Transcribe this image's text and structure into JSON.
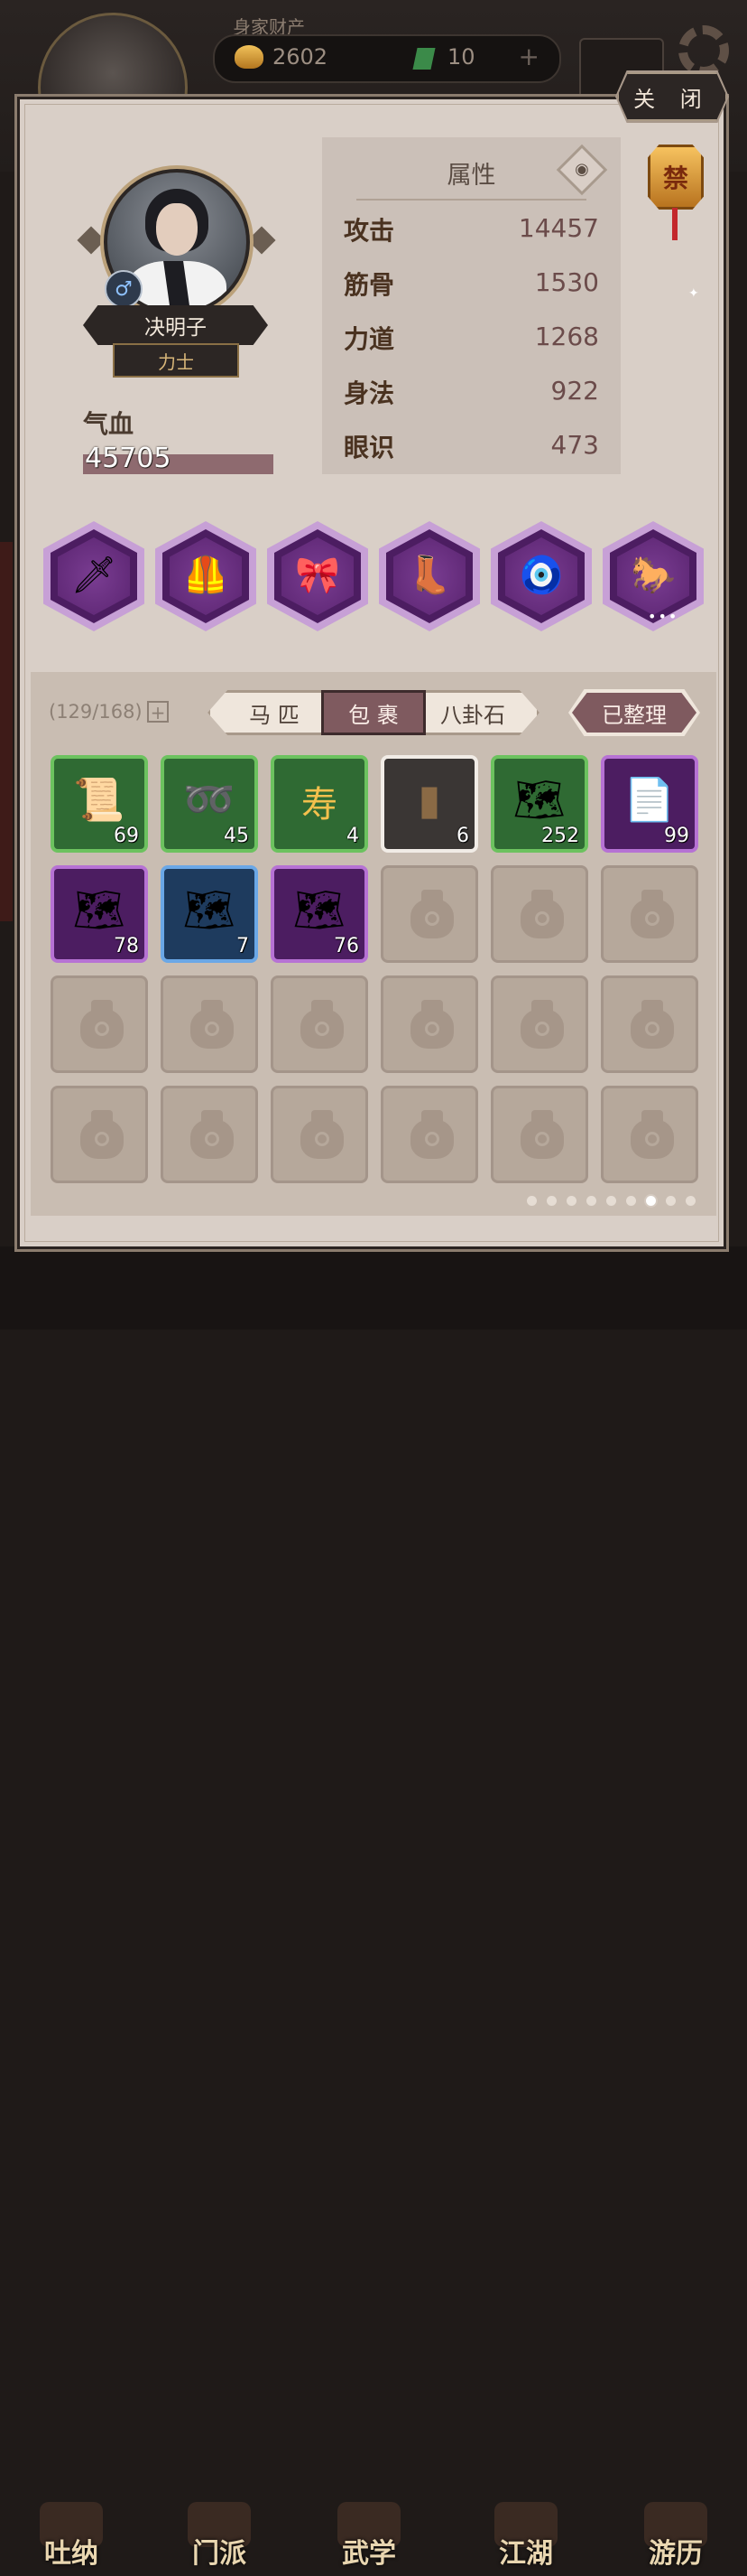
{
  "background": {
    "assets_label": "身家财产",
    "gold": "2602",
    "jade": "10",
    "bottom_tabs": [
      "吐纳",
      "门派",
      "武学",
      "江湖",
      "游历"
    ]
  },
  "dialog": {
    "close_label": "关 闭",
    "character": {
      "name": "决明子",
      "class": "力士",
      "gender_symbol": "♂",
      "hp_label": "气血",
      "hp_value": "45705"
    },
    "attributes": {
      "title": "属性",
      "rows": [
        {
          "label": "攻击",
          "value": "14457"
        },
        {
          "label": "筋骨",
          "value": "1530"
        },
        {
          "label": "力道",
          "value": "1268"
        },
        {
          "label": "身法",
          "value": "922"
        },
        {
          "label": "眼识",
          "value": "473"
        }
      ]
    },
    "badge_char": "禁",
    "equipment": [
      {
        "name": "weapon-slot",
        "icon": "sword-icon",
        "glyph": "🗡"
      },
      {
        "name": "armor-slot",
        "icon": "armor-icon",
        "glyph": "🦺"
      },
      {
        "name": "belt-slot",
        "icon": "belt-icon",
        "glyph": "🎀"
      },
      {
        "name": "boots-slot",
        "icon": "boots-icon",
        "glyph": "👢"
      },
      {
        "name": "pendant-slot",
        "icon": "pendant-icon",
        "glyph": "🧿"
      },
      {
        "name": "horse-slot",
        "icon": "horse-icon",
        "glyph": "🐎"
      }
    ],
    "inventory": {
      "capacity": "(129/168)",
      "tabs": [
        {
          "label": "马 匹",
          "active": false
        },
        {
          "label": "包 裹",
          "active": true
        },
        {
          "label": "八卦石",
          "active": false
        }
      ],
      "sorted_label": "已整理",
      "items": [
        {
          "rarity": "green",
          "icon": "scroll-icon",
          "glyph": "📜",
          "count": "69"
        },
        {
          "rarity": "green",
          "icon": "wire-coil-icon",
          "glyph": "➿",
          "count": "45"
        },
        {
          "rarity": "green",
          "icon": "longevity-charm-icon",
          "glyph": "寿",
          "count": "4"
        },
        {
          "rarity": "grey",
          "icon": "strap-icon",
          "glyph": "▮",
          "count": "6"
        },
        {
          "rarity": "green",
          "icon": "map-icon",
          "glyph": "🗺",
          "count": "252"
        },
        {
          "rarity": "purple",
          "icon": "paper-icon",
          "glyph": "📄",
          "count": "99"
        },
        {
          "rarity": "purple",
          "icon": "map-icon",
          "glyph": "🗺",
          "count": "78"
        },
        {
          "rarity": "blue",
          "icon": "map-icon",
          "glyph": "🗺",
          "count": "7"
        },
        {
          "rarity": "purple",
          "icon": "map-icon",
          "glyph": "🗺",
          "count": "76"
        }
      ],
      "page_current": 7,
      "page_total": 9
    }
  }
}
